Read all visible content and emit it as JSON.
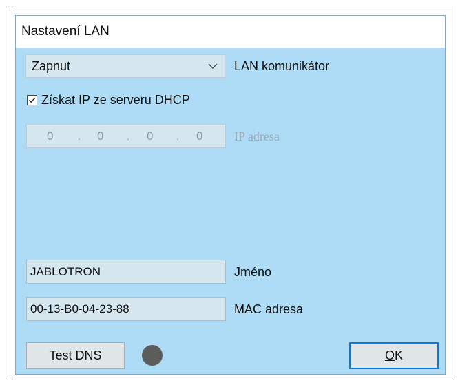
{
  "window": {
    "title": "Nastavení LAN"
  },
  "lan": {
    "mode_value": "Zapnut",
    "mode_label": "LAN komunikátor",
    "dhcp_label": "Získat IP ze serveru DHCP",
    "dhcp_checked": true,
    "ip_octets": [
      "0",
      "0",
      "0",
      "0"
    ],
    "ip_label": "IP adresa"
  },
  "device": {
    "name_value": "JABLOTRON",
    "name_label": "Jméno",
    "mac_value": "00-13-B0-04-23-88",
    "mac_label": "MAC adresa"
  },
  "buttons": {
    "test_dns": "Test DNS",
    "ok_prefix": "O",
    "ok_rest": "K"
  },
  "colors": {
    "background": "#aedcf6",
    "field": "#d6e6ef",
    "ok_border": "#0f78d7",
    "indicator": "#5c5c5c"
  },
  "icons": {
    "dropdown": "chevron-down-icon",
    "check": "check-icon",
    "status": "status-indicator"
  }
}
